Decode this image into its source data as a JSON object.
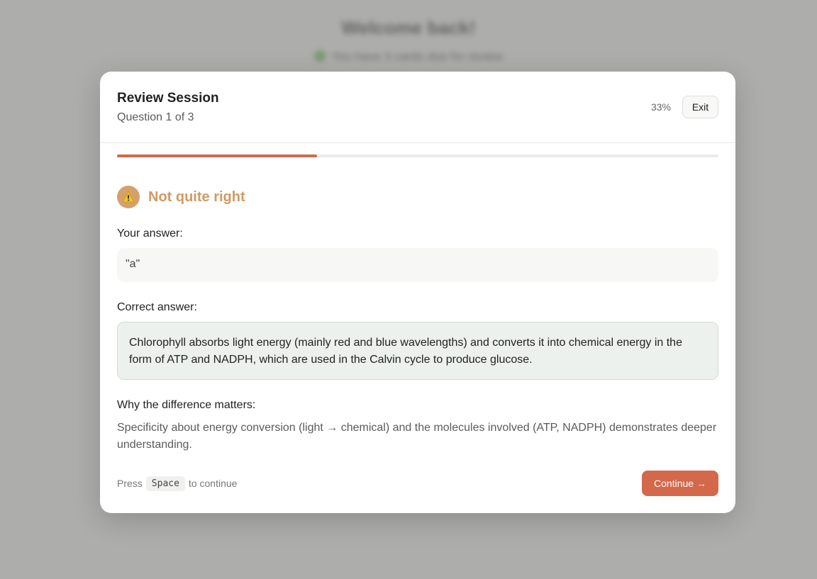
{
  "background": {
    "title": "Welcome back!",
    "subtitle": "You have 3 cards due for review"
  },
  "modal": {
    "title": "Review Session",
    "subtitle": "Question 1 of 3",
    "progress_percent_label": "33%",
    "progress_fraction": 0.333,
    "exit_label": "Exit"
  },
  "result": {
    "status_icon": "warning-icon",
    "status_text": "Not quite right",
    "your_answer_label": "Your answer:",
    "your_answer_value": "\"a\"",
    "correct_answer_label": "Correct answer:",
    "correct_answer_value": "Chlorophyll absorbs light energy (mainly red and blue wavelengths) and converts it into chemical energy in the form of ATP and NADPH, which are used in the Calvin cycle to produce glucose.",
    "why_label": "Why the difference matters:",
    "why_text": "Specificity about energy conversion (light → chemical) and the molecules involved (ATP, NADPH) demonstrates deeper understanding."
  },
  "footer": {
    "hint_prefix": "Press",
    "hint_key": "Space",
    "hint_suffix": "to continue",
    "continue_label": "Continue →"
  },
  "colors": {
    "accent": "#d4684a",
    "warning": "#d09a64",
    "correct_bg": "#ecf1ee"
  }
}
